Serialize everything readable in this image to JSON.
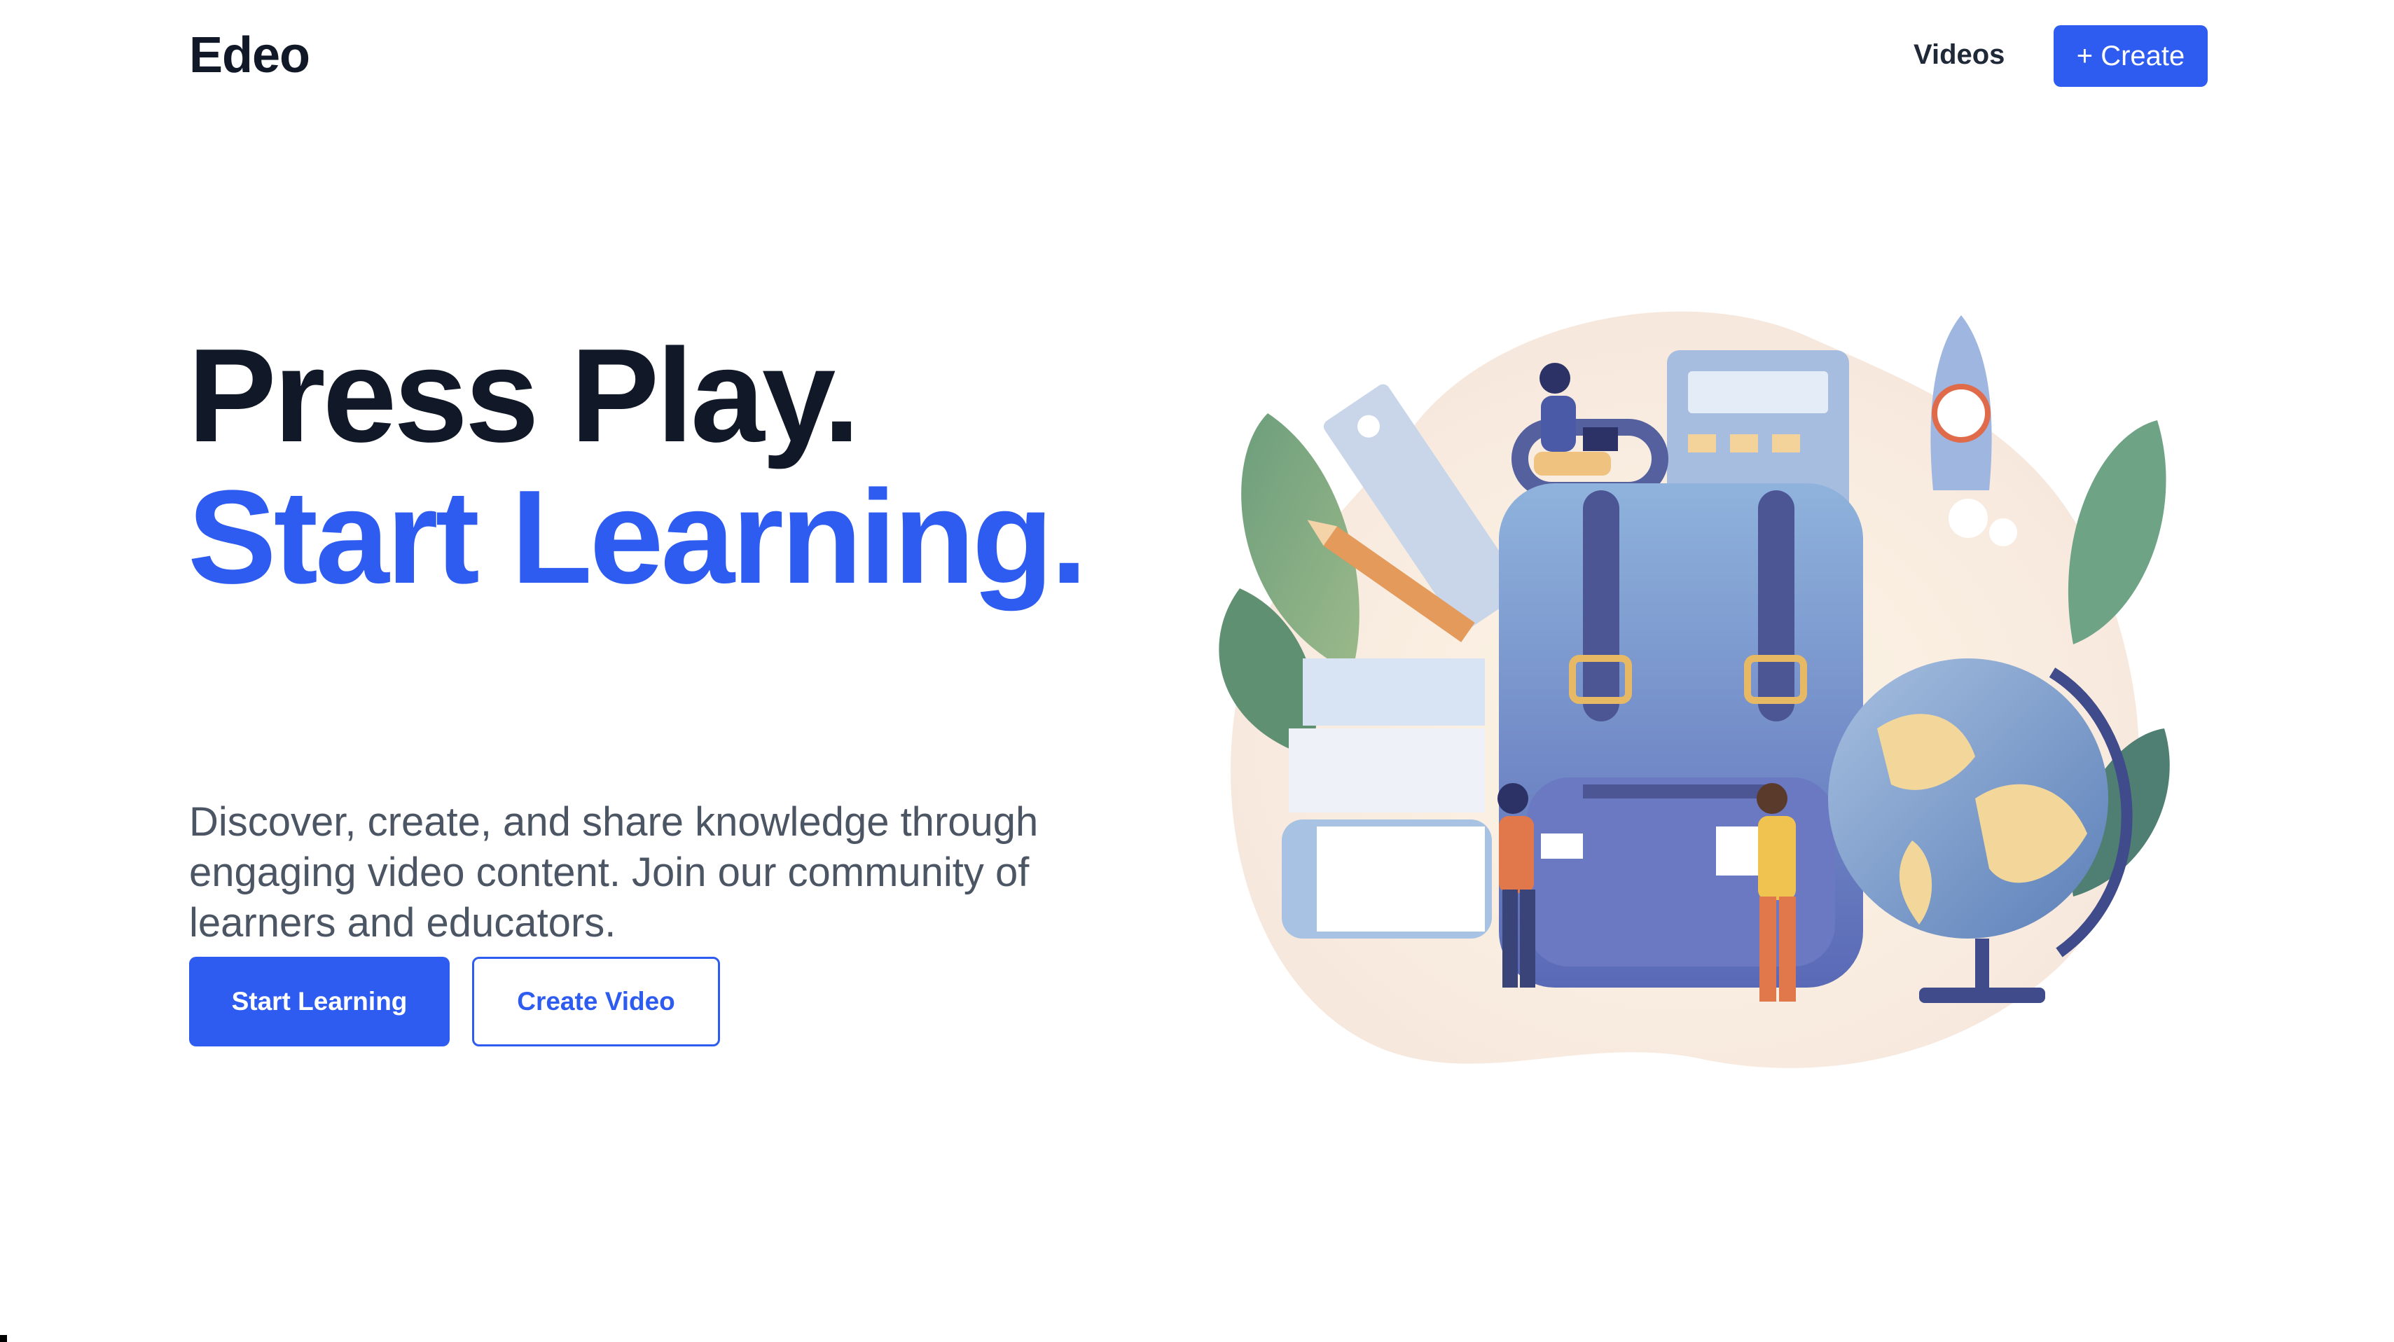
{
  "header": {
    "logo": "Edeo",
    "nav": {
      "videos_label": "Videos"
    },
    "create_label": "+ Create"
  },
  "hero": {
    "title_line1": "Press Play.",
    "title_line2": "Start Learning.",
    "description": "Discover, create, and share knowledge through engaging video content. Join our community of learners and educators.",
    "primary_button": "Start Learning",
    "secondary_button": "Create Video"
  },
  "colors": {
    "accent": "#2f5cf0",
    "heading": "#111827",
    "body_text": "#4b5563"
  },
  "illustration": {
    "icons": [
      "backpack-icon",
      "globe-icon",
      "rocket-icon",
      "calculator-icon",
      "ruler-icon",
      "pencil-icon",
      "books-icon",
      "leaves-icon",
      "student-figure-icon",
      "teacher-figure-icon",
      "laptop-user-icon"
    ]
  }
}
